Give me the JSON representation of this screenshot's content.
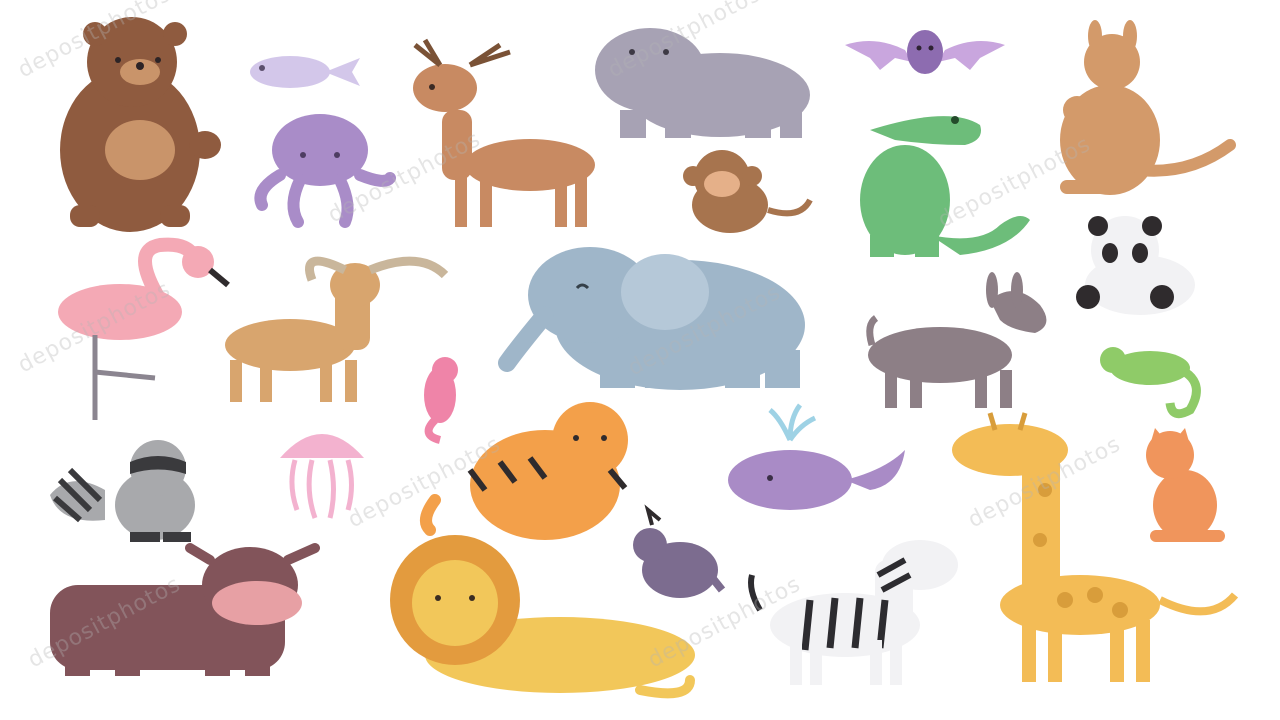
{
  "watermark": {
    "text": "depositphotos"
  },
  "colors": {
    "background": "#ffffff",
    "bear": "#8f5b3f",
    "bear_belly": "#c9946a",
    "fish": "#d3c7ea",
    "octopus": "#a98cc8",
    "deer": "#c88a62",
    "hippo": "#a7a2b4",
    "bat": "#8d6cb0",
    "bat_wing": "#c9a6de",
    "monkey": "#a7744e",
    "crocodile": "#6dbd7a",
    "kangaroo": "#d39a6a",
    "flamingo": "#f4a9b5",
    "antelope": "#d8a56e",
    "elephant": "#9fb6c9",
    "seahorse": "#ef84a8",
    "donkey": "#8d7f86",
    "panda": "#2f2b2d",
    "chameleon": "#8fcb68",
    "raccoon": "#a8a9ac",
    "jellyfish": "#f3b2cf",
    "tiger": "#f3a04a",
    "whale": "#a98bc6",
    "giraffe": "#f3bc56",
    "fox_cat": "#f0955c",
    "yak": "#82545a",
    "lion": "#f2c75a",
    "lion_mane": "#e39b3e",
    "quail": "#7c6c8f",
    "zebra": "#2d2c30"
  },
  "animals": [
    {
      "name": "bear"
    },
    {
      "name": "fish"
    },
    {
      "name": "octopus"
    },
    {
      "name": "deer"
    },
    {
      "name": "hippo"
    },
    {
      "name": "bat"
    },
    {
      "name": "monkey"
    },
    {
      "name": "crocodile"
    },
    {
      "name": "kangaroo"
    },
    {
      "name": "flamingo"
    },
    {
      "name": "antelope"
    },
    {
      "name": "elephant"
    },
    {
      "name": "seahorse"
    },
    {
      "name": "donkey"
    },
    {
      "name": "panda"
    },
    {
      "name": "chameleon"
    },
    {
      "name": "raccoon"
    },
    {
      "name": "jellyfish"
    },
    {
      "name": "tiger"
    },
    {
      "name": "whale"
    },
    {
      "name": "giraffe"
    },
    {
      "name": "cat"
    },
    {
      "name": "yak"
    },
    {
      "name": "lion"
    },
    {
      "name": "quail"
    },
    {
      "name": "zebra"
    }
  ]
}
